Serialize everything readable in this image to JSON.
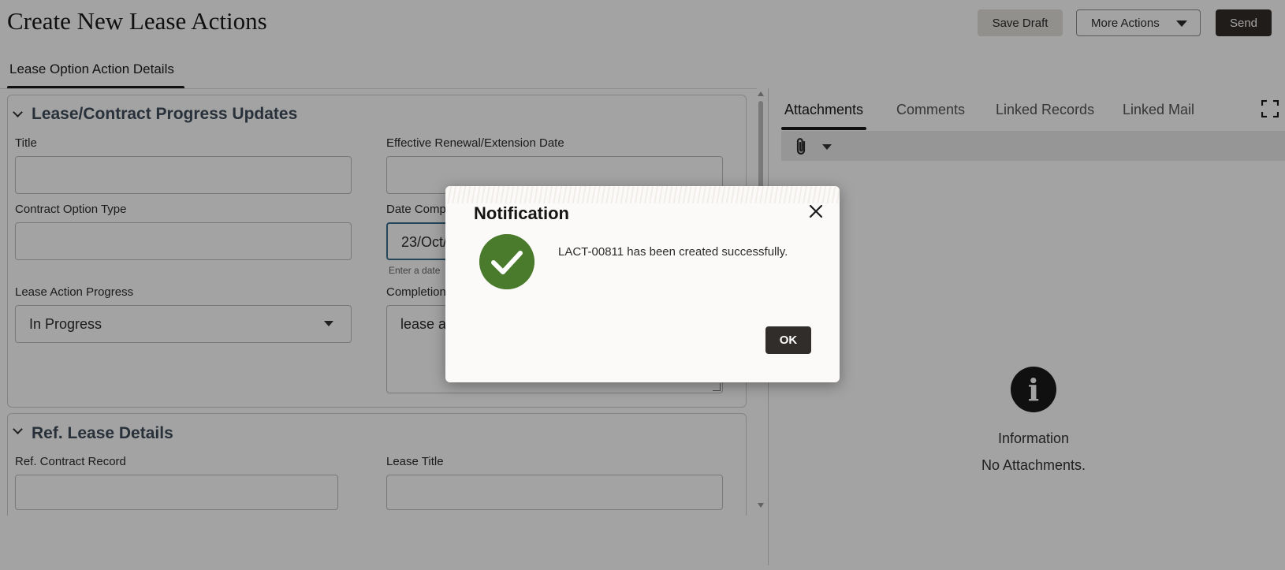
{
  "header": {
    "title": "Create New Lease Actions",
    "save_draft": "Save Draft",
    "more_actions": "More Actions",
    "send": "Send"
  },
  "left_tabs": [
    "Lease Option Action Details"
  ],
  "section_progress": {
    "title": "Lease/Contract Progress Updates",
    "title_label": "Title",
    "title_value": "",
    "effective_date_label": "Effective Renewal/Extension Date",
    "effective_date_value": "",
    "option_type_label": "Contract Option Type",
    "option_type_value": "",
    "date_completed_label": "Date Comp",
    "date_completed_value": "23/Oct/",
    "date_completed_hint": "Enter a date",
    "progress_label": "Lease Action Progress",
    "progress_value": "In Progress",
    "completion_label": "Completion",
    "completion_value": "lease ac"
  },
  "section_ref": {
    "title": "Ref. Lease Details",
    "contract_label": "Ref. Contract Record",
    "contract_value": "",
    "lease_title_label": "Lease Title",
    "lease_title_value": ""
  },
  "right_panel": {
    "tabs": [
      "Attachments",
      "Comments",
      "Linked Records",
      "Linked Mail"
    ],
    "active_tab": "Attachments",
    "info_title": "Information",
    "info_message": "No Attachments."
  },
  "dialog": {
    "title": "Notification",
    "message": "LACT-00811 has been created successfully.",
    "ok_label": "OK"
  },
  "colors": {
    "success": "#4a7a2c",
    "primary_button": "#312d2a",
    "section_title": "#3f4d5c"
  }
}
